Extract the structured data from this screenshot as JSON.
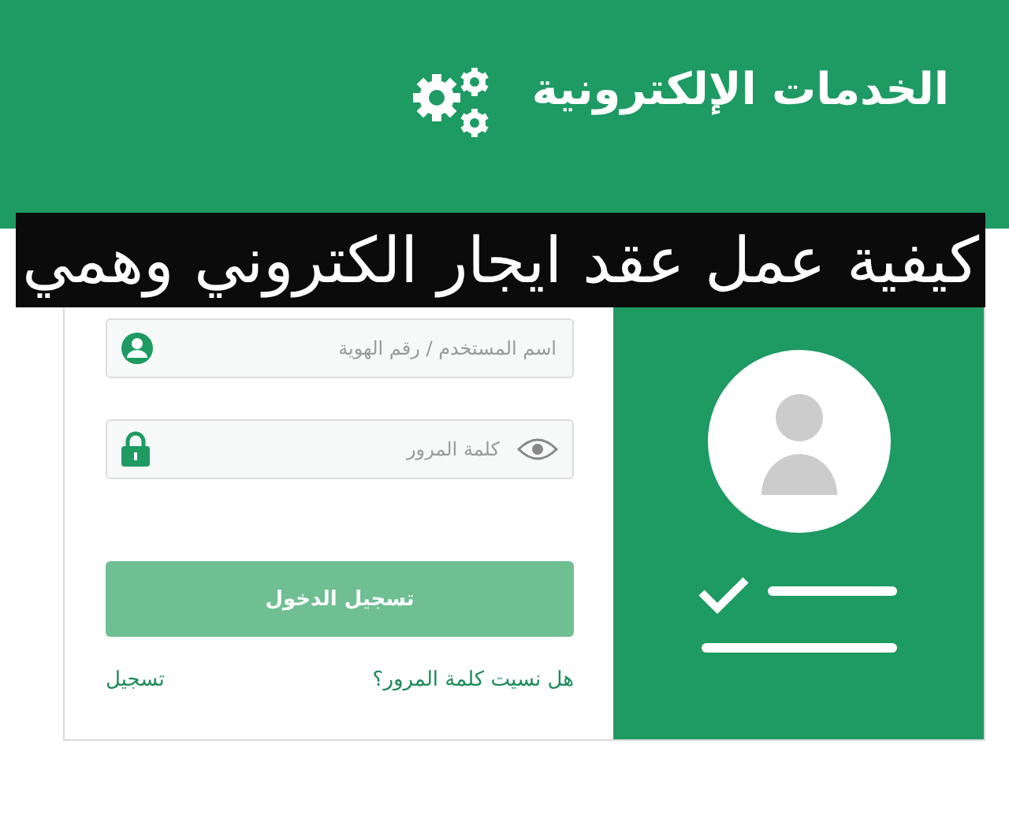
{
  "header": {
    "title": "الخدمات الإلكترونية"
  },
  "banner": {
    "title": "كيفية عمل عقد ايجار الكتروني وهمي"
  },
  "form": {
    "fields": [
      {
        "kind": "user",
        "placeholder": "اسم المستخدم / رقم الهوية"
      },
      {
        "kind": "password",
        "placeholder": "كلمة المرور"
      }
    ],
    "submit": "تسجيل الدخول",
    "forgot_link": "هل نسيت كلمة المرور؟",
    "register_link": "تسجيل"
  }
}
